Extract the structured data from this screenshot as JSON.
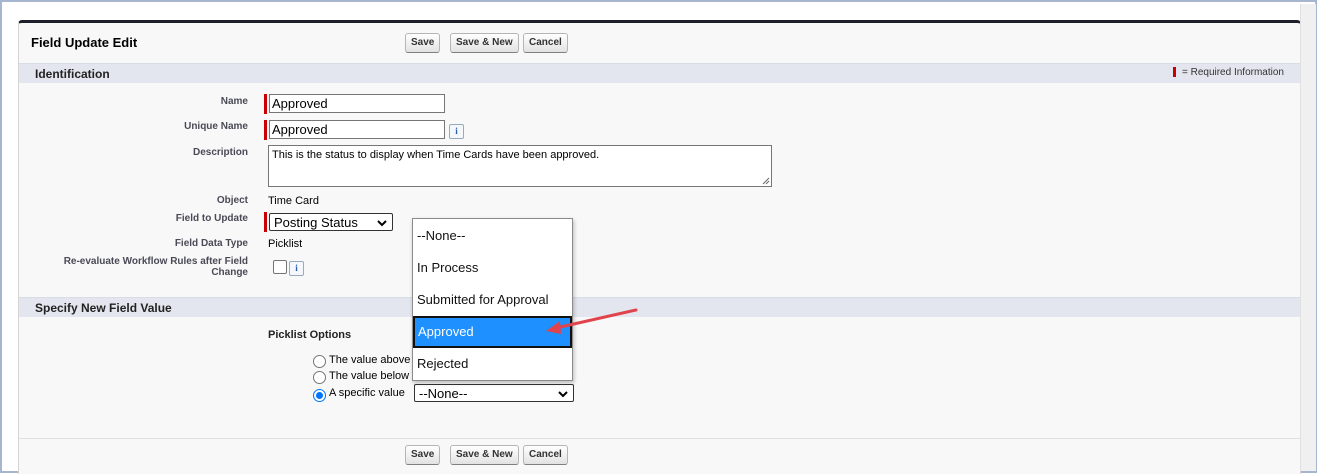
{
  "page_title": "Field Update Edit",
  "buttons": {
    "save": "Save",
    "save_new": "Save & New",
    "cancel": "Cancel"
  },
  "identification": {
    "heading": "Identification",
    "required_legend": "= Required Information",
    "name_label": "Name",
    "name_value": "Approved",
    "unique_name_label": "Unique Name",
    "unique_name_value": "Approved",
    "description_label": "Description",
    "description_value": "This is the status to display when Time Cards have been approved.",
    "object_label": "Object",
    "object_value": "Time Card",
    "field_to_update_label": "Field to Update",
    "field_to_update_value": "Posting Status",
    "field_data_type_label": "Field Data Type",
    "field_data_type_value": "Picklist",
    "reevaluate_label_line1": "Re-evaluate Workflow Rules after Field",
    "reevaluate_label_line2": "Change",
    "info_glyph": "i"
  },
  "new_value": {
    "heading": "Specify New Field Value",
    "picklist_options_label": "Picklist Options",
    "radio_above": "The value above",
    "radio_below": "The value below",
    "radio_specific": "A specific value",
    "specific_select_value": "--None--",
    "selected_radio": "specific"
  },
  "dropdown_options": [
    "--None--",
    "In Process",
    "Submitted for Approval",
    "Approved",
    "Rejected"
  ],
  "dropdown_selected": "Approved",
  "colors": {
    "required": "#cc0000",
    "selection": "#1e90ff",
    "arrow": "#e0434b",
    "panel_border": "#1d1f2a"
  }
}
